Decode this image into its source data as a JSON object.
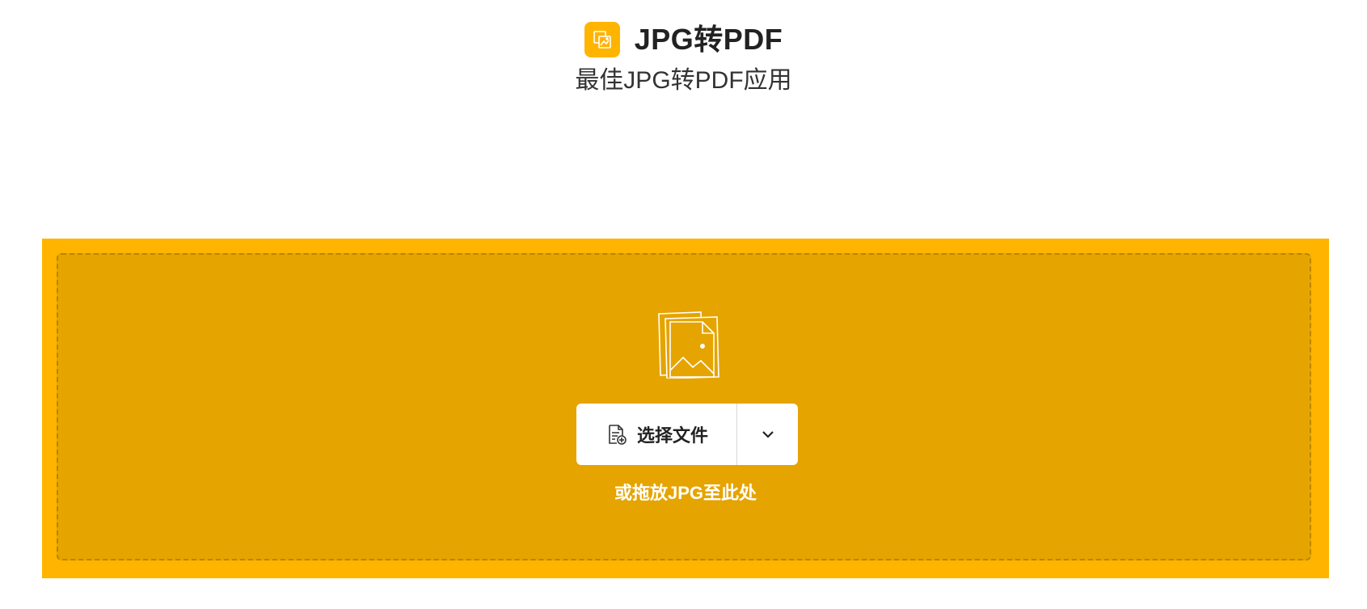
{
  "header": {
    "title": "JPG转PDF",
    "subtitle": "最佳JPG转PDF应用",
    "logo_icon": "image-convert-icon"
  },
  "dropzone": {
    "illustration_icon": "image-files-icon",
    "select_button": {
      "label": "选择文件",
      "icon": "file-add-icon"
    },
    "more_button_icon": "chevron-down-icon",
    "hint": "或拖放JPG至此处"
  },
  "colors": {
    "accent": "#ffb400",
    "dropzone_inner": "#e5a400",
    "white": "#ffffff",
    "text": "#222222"
  }
}
